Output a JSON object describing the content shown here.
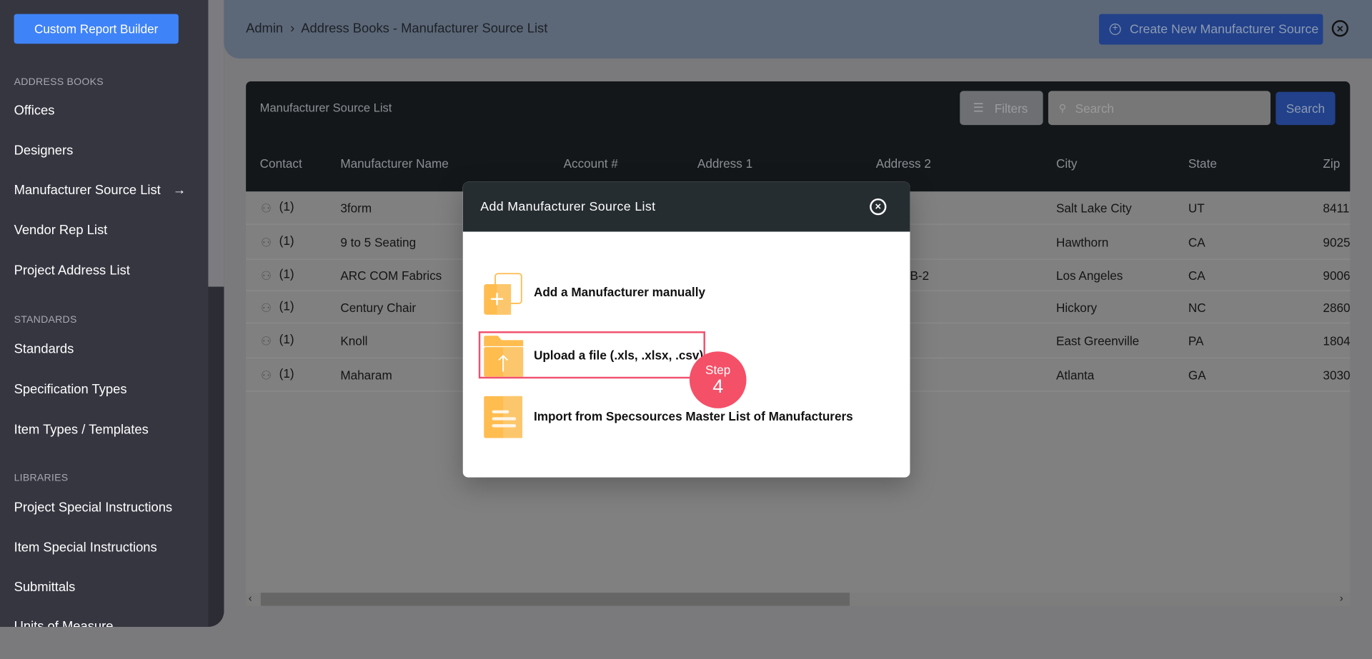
{
  "sidebar": {
    "custom_report_builder": "Custom Report Builder",
    "sections": [
      {
        "title": "ADDRESS BOOKS",
        "items": [
          "Offices",
          "Designers",
          "Manufacturer Source List",
          "Vendor Rep List",
          "Project Address List"
        ]
      },
      {
        "title": "STANDARDS",
        "items": [
          "Standards",
          "Specification Types",
          "Item Types / Templates"
        ]
      },
      {
        "title": "LIBRARIES",
        "items": [
          "Project Special Instructions",
          "Item Special Instructions",
          "Submittals",
          "Units of Measure"
        ]
      }
    ],
    "active_item": "Manufacturer Source List"
  },
  "header": {
    "breadcrumb_root": "Admin",
    "breadcrumb_sep": "›",
    "breadcrumb_page": "Address Books - Manufacturer Source List",
    "create_button": "Create New Manufacturer Source"
  },
  "table": {
    "title": "Manufacturer Source List",
    "filters_label": "Filters",
    "search_placeholder": "Search",
    "search_button": "Search",
    "columns": [
      "Contact",
      "Manufacturer Name",
      "Account #",
      "Address 1",
      "Address 2",
      "City",
      "State",
      "Zip"
    ],
    "rows": [
      {
        "contact": "(1)",
        "name": "3form",
        "address2": "",
        "city": "Salt Lake City",
        "state": "UT",
        "zip": "8411"
      },
      {
        "contact": "(1)",
        "name": "9 to 5 Seating",
        "address2": "",
        "city": "Hawthorn",
        "state": "CA",
        "zip": "9025"
      },
      {
        "contact": "(1)",
        "name": "ARC COM Fabrics",
        "address2": "B-2",
        "city": "Los Angeles",
        "state": "CA",
        "zip": "9006"
      },
      {
        "contact": "(1)",
        "name": "Century Chair",
        "address2": "",
        "city": "Hickory",
        "state": "NC",
        "zip": "2860"
      },
      {
        "contact": "(1)",
        "name": "Knoll",
        "address2": "",
        "city": "East Greenville",
        "state": "PA",
        "zip": "1804"
      },
      {
        "contact": "(1)",
        "name": "Maharam",
        "address2": "",
        "city": "Atlanta",
        "state": "GA",
        "zip": "3030"
      }
    ]
  },
  "modal": {
    "title": "Add Manufacturer Source List",
    "options": [
      "Add a Manufacturer manually",
      "Upload a file (.xls, .xlsx, .csv)",
      "Import from Specsources Master List of Manufacturers"
    ]
  },
  "step_badge": {
    "label": "Step",
    "number": "4"
  },
  "colors": {
    "primary": "#3f83f8",
    "icon_orange": "#ffbc4f",
    "highlight": "#f45067"
  }
}
